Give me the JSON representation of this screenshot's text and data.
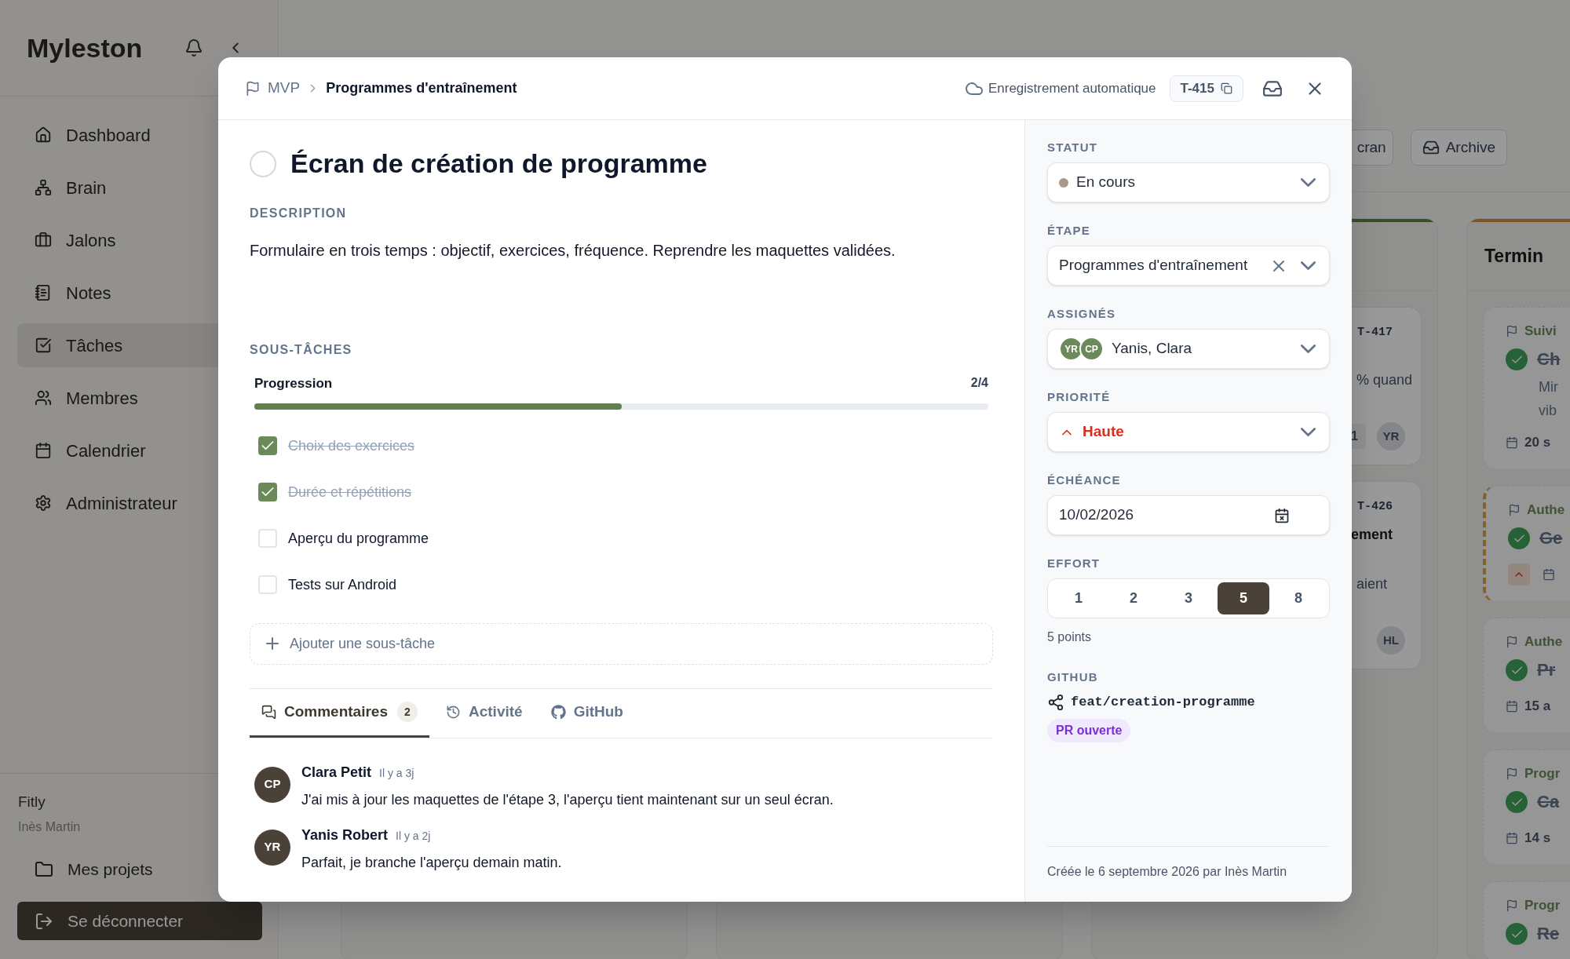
{
  "sidebar": {
    "logo": "Myleston",
    "nav": [
      {
        "label": "Dashboard",
        "selected": false
      },
      {
        "label": "Brain",
        "selected": false
      },
      {
        "label": "Jalons",
        "selected": false
      },
      {
        "label": "Notes",
        "selected": false
      },
      {
        "label": "Tâches",
        "selected": true
      },
      {
        "label": "Membres",
        "selected": false
      },
      {
        "label": "Calendrier",
        "selected": false
      },
      {
        "label": "Administrateur",
        "selected": false
      }
    ],
    "workspace": "Fitly",
    "user": "Inès Martin",
    "projects_link": "Mes projets",
    "logout": "Se déconnecter"
  },
  "board": {
    "toolbar_buttons": [
      "cran",
      "Archive"
    ],
    "columns": [
      {
        "cards": [
          {
            "kind": "task",
            "id": "T-417",
            "lines": [
              "% quand"
            ],
            "count": "1",
            "assignee": "YR"
          },
          {
            "kind": "task",
            "id": "T-426",
            "title": "ement",
            "lines": [
              "aient"
            ],
            "assignee": "HL"
          }
        ]
      },
      {
        "title": "Termin",
        "cards": [
          {
            "kind": "done",
            "milestone": "Suivi",
            "title": "Ch",
            "lines": [
              "Mir",
              "vib"
            ],
            "date": "20 s",
            "flagged": false
          },
          {
            "kind": "done",
            "milestone": "Authe",
            "title": "Ge",
            "priority": true,
            "flagged": true
          },
          {
            "kind": "done",
            "milestone": "Authe",
            "title": "Pr",
            "date": "15 a",
            "flagged": false
          },
          {
            "kind": "done",
            "milestone": "Progr",
            "title": "Ca",
            "date": "14 s",
            "flagged": false
          },
          {
            "kind": "done",
            "milestone": "Progr",
            "title": "Re",
            "flagged": false
          }
        ]
      }
    ]
  },
  "modal": {
    "breadcrumb": [
      "MVP",
      "Programmes d'entraînement"
    ],
    "autosave": "Enregistrement automatique",
    "task_id": "T-415",
    "title": "Écran de création de programme",
    "completed": false,
    "description_label": "DESCRIPTION",
    "description": "Formulaire en trois temps : objectif, exercices, fréquence. Reprendre les maquettes validées.",
    "subtasks_label": "SOUS-TÂCHES",
    "progress": {
      "label": "Progression",
      "reading": "2/4",
      "level": 0.5
    },
    "subtasks": [
      {
        "label": "Choix des exercices",
        "checked": true
      },
      {
        "label": "Durée et répétitions",
        "checked": true
      },
      {
        "label": "Aperçu du programme",
        "checked": false
      },
      {
        "label": "Tests sur Android",
        "checked": false
      }
    ],
    "add_subtask": "Ajouter une sous-tâche",
    "tabs": [
      {
        "label": "Commentaires",
        "count": "2",
        "selected": true
      },
      {
        "label": "Activité",
        "selected": false
      },
      {
        "label": "GitHub",
        "selected": false
      }
    ],
    "comments": [
      {
        "initials": "CP",
        "author": "Clara Petit",
        "time": "Il y a 3j",
        "text": "J'ai mis à jour les maquettes de l'étape 3, l'aperçu tient maintenant sur un seul écran."
      },
      {
        "initials": "YR",
        "author": "Yanis Robert",
        "time": "Il y a 2j",
        "text": "Parfait, je branche l'aperçu demain matin."
      }
    ],
    "details": {
      "status": {
        "label": "STATUT",
        "value": "En cours",
        "color": "#a89a88"
      },
      "stage": {
        "label": "ÉTAPE",
        "value": "Programmes d'entraînement"
      },
      "assignees": {
        "label": "ASSIGNÉS",
        "people": [
          "YR",
          "CP"
        ],
        "value": "Yanis, Clara"
      },
      "priority": {
        "label": "PRIORITÉ",
        "value": "Haute",
        "kind": "high"
      },
      "due": {
        "label": "ÉCHÉANCE",
        "value": "10/02/2026"
      },
      "effort": {
        "label": "EFFORT",
        "options": [
          {
            "label": "1",
            "selected": false
          },
          {
            "label": "2",
            "selected": false
          },
          {
            "label": "3",
            "selected": false
          },
          {
            "label": "5",
            "selected": true
          },
          {
            "label": "8",
            "selected": false
          }
        ],
        "caption": "5 points"
      },
      "github": {
        "label": "GITHUB",
        "branch": "feat/creation-programme",
        "pr": "PR ouverte"
      },
      "footer": "Créée le 6 septembre 2026 par Inès Martin"
    }
  }
}
